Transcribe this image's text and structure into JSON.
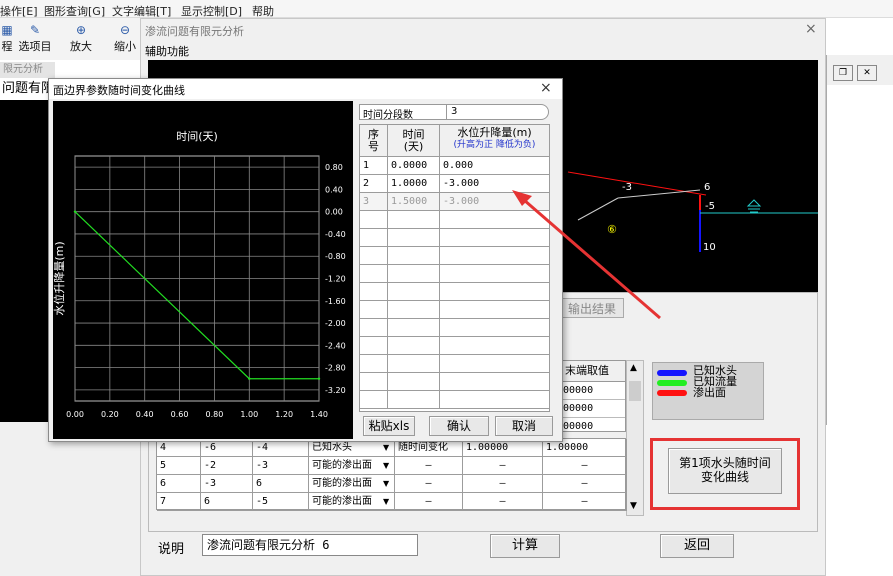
{
  "menu": [
    "操作[E]",
    "图形查询[G]",
    "文字编辑[T]",
    "显示控制[D]",
    "帮助"
  ],
  "toolbar": [
    {
      "icon": "project-icon",
      "label": "程"
    },
    {
      "icon": "select-project-icon",
      "label": "选项目"
    },
    {
      "icon": "zoom-in-icon",
      "label": "放大"
    },
    {
      "icon": "zoom-out-icon",
      "label": "缩小"
    }
  ],
  "bg_window": {
    "title": "限元分析",
    "tab_label": "问题有限元"
  },
  "main_dialog": {
    "title": "渗流问题有限元分析",
    "menu_item": "辅助功能",
    "close": "×",
    "output_tab": "输出结果",
    "right_col_header": "末端取值",
    "right_col_values": [
      "00000",
      "00000",
      "00000"
    ],
    "table_rows": [
      [
        "4",
        "-6",
        "-4",
        "已知水头",
        "随时间变化",
        "1.00000",
        "1.00000"
      ],
      [
        "5",
        "-2",
        "-3",
        "可能的渗出面",
        "—",
        "—",
        "—"
      ],
      [
        "6",
        "-3",
        "6",
        "可能的渗出面",
        "—",
        "—",
        "—"
      ],
      [
        "7",
        "6",
        "-5",
        "可能的渗出面",
        "—",
        "—",
        "—"
      ]
    ],
    "legend": [
      "已知水头",
      "已知流量",
      "渗出面"
    ],
    "legend_colors": [
      "#1515ff",
      "#22ee22",
      "#ff1111"
    ],
    "curve_button": "第1项水头随时间\n变化曲线",
    "desc_label": "说明",
    "desc_value": "渗流问题有限元分析 6",
    "calc_button": "计算",
    "return_button": "返回"
  },
  "viewport": {
    "labels": [
      "-3",
      "6",
      "-5",
      "10",
      "⑥"
    ]
  },
  "curve_dialog": {
    "title": "面边界参数随时间变化曲线",
    "close": "×",
    "chart_title": "时间(天)",
    "ylabel": "水位升降量(m)",
    "y_ticks": [
      "0.80",
      "0.40",
      "0.00",
      "-0.40",
      "-0.80",
      "-1.20",
      "-1.60",
      "-2.00",
      "-2.40",
      "-2.80",
      "-3.20"
    ],
    "x_ticks": [
      "0.00",
      "0.20",
      "0.40",
      "0.60",
      "0.80",
      "1.00",
      "1.20",
      "1.40"
    ],
    "segments_label": "时间分段数",
    "segments_value": "3",
    "col_headers": {
      "idx": "序\n号",
      "time": "时间\n(天)",
      "level": "水位升降量(m)",
      "level_note": "(升高为正 降低为负)"
    },
    "rows": [
      [
        "1",
        "0.0000",
        "0.000"
      ],
      [
        "2",
        "1.0000",
        "-3.000"
      ],
      [
        "3",
        "1.5000",
        "-3.000"
      ]
    ],
    "paste_button": "粘贴xls",
    "ok_button": "确认",
    "cancel_button": "取消"
  },
  "chart_data": {
    "type": "line",
    "title": "时间(天)",
    "xlabel": "",
    "ylabel": "水位升降量(m)",
    "x": [
      0.0,
      1.0,
      1.5
    ],
    "series": [
      {
        "values": [
          0.0,
          -3.0,
          -3.0
        ]
      }
    ],
    "xlim": [
      0,
      1.4
    ],
    "ylim": [
      -3.4,
      1.0
    ],
    "grid": true,
    "line_color": "#22dd22",
    "background": "#000000"
  },
  "colors": {
    "accent_red": "#e53333",
    "seepage": "#ff1111",
    "known_head": "#1515ff"
  }
}
